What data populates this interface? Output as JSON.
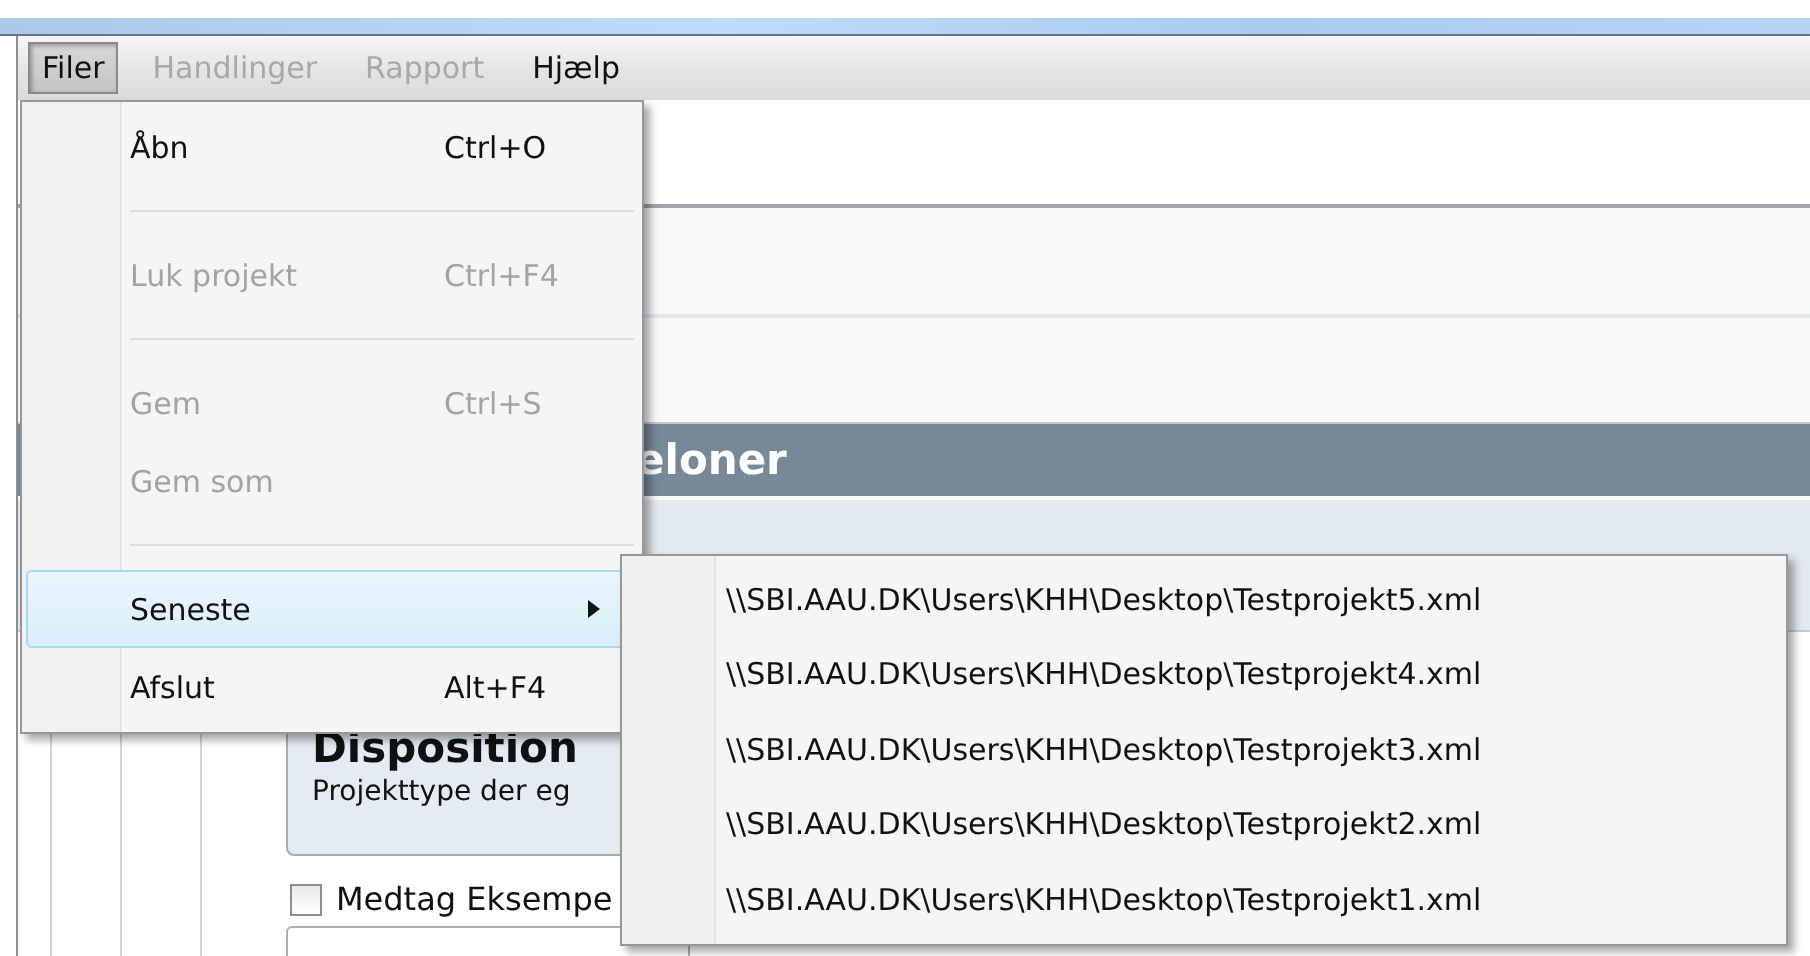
{
  "menubar": [
    {
      "label": "Filer",
      "selected": true,
      "disabled": false
    },
    {
      "label": "Handlinger",
      "selected": false,
      "disabled": true
    },
    {
      "label": "Rapport",
      "selected": false,
      "disabled": true
    },
    {
      "label": "Hjælp",
      "selected": false,
      "disabled": false
    }
  ],
  "file_menu": {
    "items": [
      {
        "kind": "item",
        "label": "Åbn",
        "shortcut": "Ctrl+O",
        "disabled": false,
        "selected": false
      },
      {
        "kind": "separator"
      },
      {
        "kind": "item",
        "label": "Luk projekt",
        "shortcut": "Ctrl+F4",
        "disabled": true,
        "selected": false
      },
      {
        "kind": "separator"
      },
      {
        "kind": "item",
        "label": "Gem",
        "shortcut": "Ctrl+S",
        "disabled": true,
        "selected": false
      },
      {
        "kind": "item",
        "label": "Gem som",
        "disabled": true,
        "selected": false
      },
      {
        "kind": "separator"
      },
      {
        "kind": "submenu",
        "label": "Seneste",
        "disabled": false,
        "selected": true
      },
      {
        "kind": "item",
        "label": "Afslut",
        "shortcut": "Alt+F4",
        "disabled": false,
        "selected": false
      }
    ]
  },
  "recent_submenu": {
    "items": [
      "\\\\SBI.AAU.DK\\Users\\KHH\\Desktop\\Testprojekt5.xml",
      "\\\\SBI.AAU.DK\\Users\\KHH\\Desktop\\Testprojekt4.xml",
      "\\\\SBI.AAU.DK\\Users\\KHH\\Desktop\\Testprojekt3.xml",
      "\\\\SBI.AAU.DK\\Users\\KHH\\Desktop\\Testprojekt2.xml",
      "\\\\SBI.AAU.DK\\Users\\KHH\\Desktop\\Testprojekt1.xml"
    ]
  },
  "content": {
    "section_header": "eloner",
    "card": {
      "title": "Disposition",
      "subtitle": "Projekttype der eg"
    },
    "checkbox": {
      "label": "Medtag Eksempe",
      "checked": false
    }
  }
}
